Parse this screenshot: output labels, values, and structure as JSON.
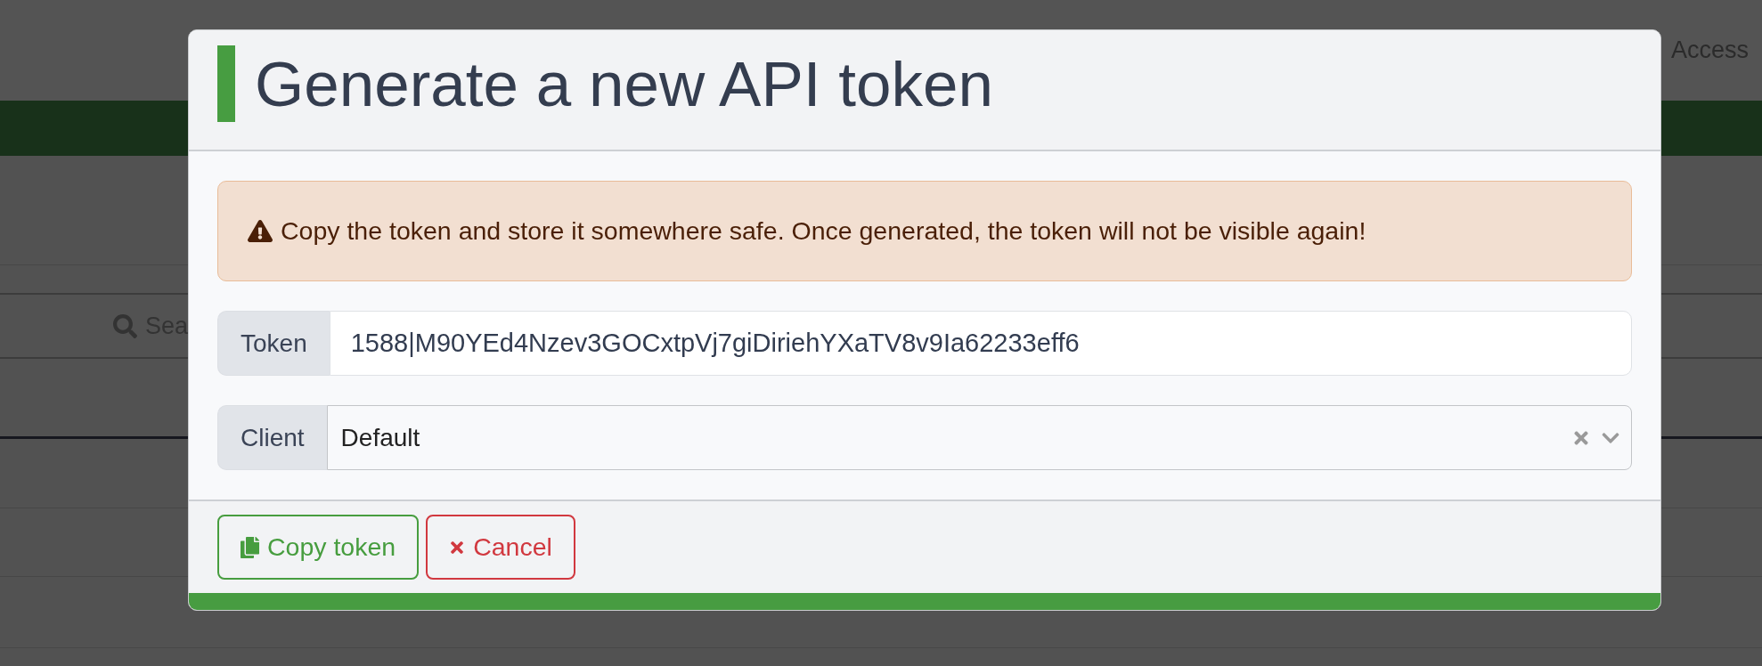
{
  "background": {
    "nav_link": "Access",
    "search_label": "Sea"
  },
  "dialog": {
    "title": "Generate a new API token",
    "alert": "Copy the token and store it somewhere safe. Once generated, the token will not be visible again!",
    "fields": [
      {
        "kind": "text",
        "label": "Token",
        "value": "1588|M90YEd4Nzev3GOCxtpVj7giDiriehYXaTV8v9Ia62233eff6"
      },
      {
        "kind": "select",
        "label": "Client",
        "value": "Default"
      }
    ],
    "buttons": [
      {
        "kind": "confirm",
        "label": "Copy token"
      },
      {
        "kind": "cancel",
        "label": "Cancel"
      }
    ]
  }
}
